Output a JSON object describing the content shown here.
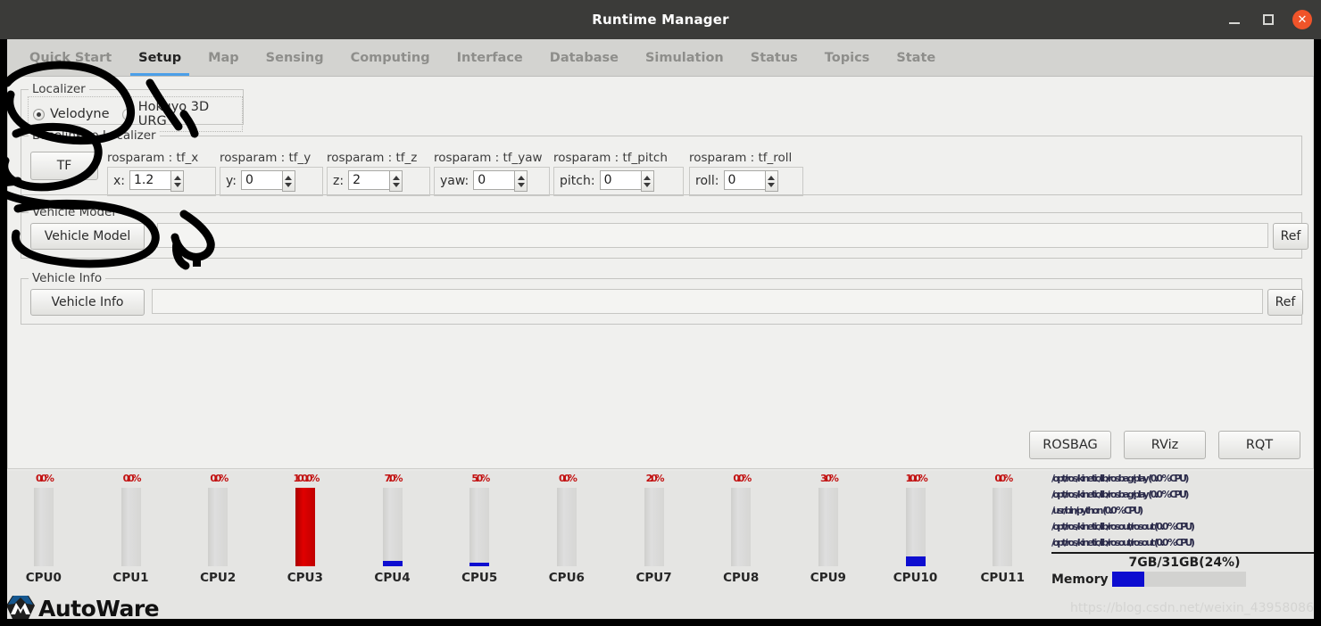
{
  "window": {
    "title": "Runtime Manager",
    "minimize_label": "_",
    "maximize_label": "□",
    "close_label": "✕"
  },
  "tabs": [
    {
      "label": "Quick Start",
      "active": false
    },
    {
      "label": "Setup",
      "active": true
    },
    {
      "label": "Map",
      "active": false
    },
    {
      "label": "Sensing",
      "active": false
    },
    {
      "label": "Computing",
      "active": false
    },
    {
      "label": "Interface",
      "active": false
    },
    {
      "label": "Database",
      "active": false
    },
    {
      "label": "Simulation",
      "active": false
    },
    {
      "label": "Status",
      "active": false
    },
    {
      "label": "Topics",
      "active": false
    },
    {
      "label": "State",
      "active": false
    }
  ],
  "localizer": {
    "legend": "Localizer",
    "options": [
      {
        "label": "Velodyne",
        "selected": true
      },
      {
        "label": "Hokuyo 3D URG",
        "selected": false
      }
    ]
  },
  "baselink": {
    "legend": "Baselink to Localizer",
    "tf_button": "TF",
    "fields": [
      {
        "title": "rosparam : tf_x",
        "label": "x:",
        "value": "1.2"
      },
      {
        "title": "rosparam : tf_y",
        "label": "y:",
        "value": "0"
      },
      {
        "title": "rosparam : tf_z",
        "label": "z:",
        "value": "2"
      },
      {
        "title": "rosparam : tf_yaw",
        "label": "yaw:",
        "value": "0"
      },
      {
        "title": "rosparam : tf_pitch",
        "label": "pitch:",
        "value": "0"
      },
      {
        "title": "rosparam : tf_roll",
        "label": "roll:",
        "value": "0"
      }
    ]
  },
  "vehicle_model": {
    "legend": "Vehicle Model",
    "button": "Vehicle Model",
    "path_value": "",
    "ref_button": "Ref"
  },
  "vehicle_info": {
    "legend": "Vehicle Info",
    "button": "Vehicle Info",
    "path_value": "",
    "ref_button": "Ref"
  },
  "actions": [
    {
      "label": "ROSBAG"
    },
    {
      "label": "RViz"
    },
    {
      "label": "RQT"
    }
  ],
  "monitor": {
    "cpus": [
      {
        "name": "CPU0",
        "pct": "0.0%",
        "value": 0,
        "color": "none"
      },
      {
        "name": "CPU1",
        "pct": "0.0%",
        "value": 0,
        "color": "none"
      },
      {
        "name": "CPU2",
        "pct": "0.0%",
        "value": 0,
        "color": "none"
      },
      {
        "name": "CPU3",
        "pct": "100.0%",
        "value": 100,
        "color": "red"
      },
      {
        "name": "CPU4",
        "pct": "7.0%",
        "value": 7,
        "color": "blue"
      },
      {
        "name": "CPU5",
        "pct": "5.0%",
        "value": 5,
        "color": "blue"
      },
      {
        "name": "CPU6",
        "pct": "0.0%",
        "value": 0,
        "color": "none"
      },
      {
        "name": "CPU7",
        "pct": "2.0%",
        "value": 0,
        "color": "none"
      },
      {
        "name": "CPU8",
        "pct": "0.0%",
        "value": 0,
        "color": "none"
      },
      {
        "name": "CPU9",
        "pct": "3.0%",
        "value": 0,
        "color": "none"
      },
      {
        "name": "CPU10",
        "pct": "10.0%",
        "value": 13,
        "color": "blue"
      },
      {
        "name": "CPU11",
        "pct": "0.0%",
        "value": 0,
        "color": "none"
      }
    ],
    "processes": [
      "/opt/ros/kinetic/lib/rosbag/play (0.0 %CPU)",
      "/opt/ros/kinetic/lib/rosbag/play (0.0 %CPU)",
      "/usr/bin/python (0.0 %CPU)",
      "/opt/ros/kinetic/lib/rosout/rosout (0.0 %CPU)",
      "/opt/ros/kinetic/lib/rosout/rosout (0.0 %CPU)"
    ],
    "memory_text": "7GB/31GB(24%)",
    "memory_label": "Memory",
    "memory_percent": 24
  },
  "footer": {
    "brand": "AutoWare",
    "watermark": "https://blog.csdn.net/weixin_43958086"
  },
  "colors": {
    "accent": "#4b9fe8",
    "close": "#f0542a",
    "cpu_high": "#c00000",
    "cpu_low": "#0d0dd0",
    "titlebar": "#3b3b39"
  }
}
